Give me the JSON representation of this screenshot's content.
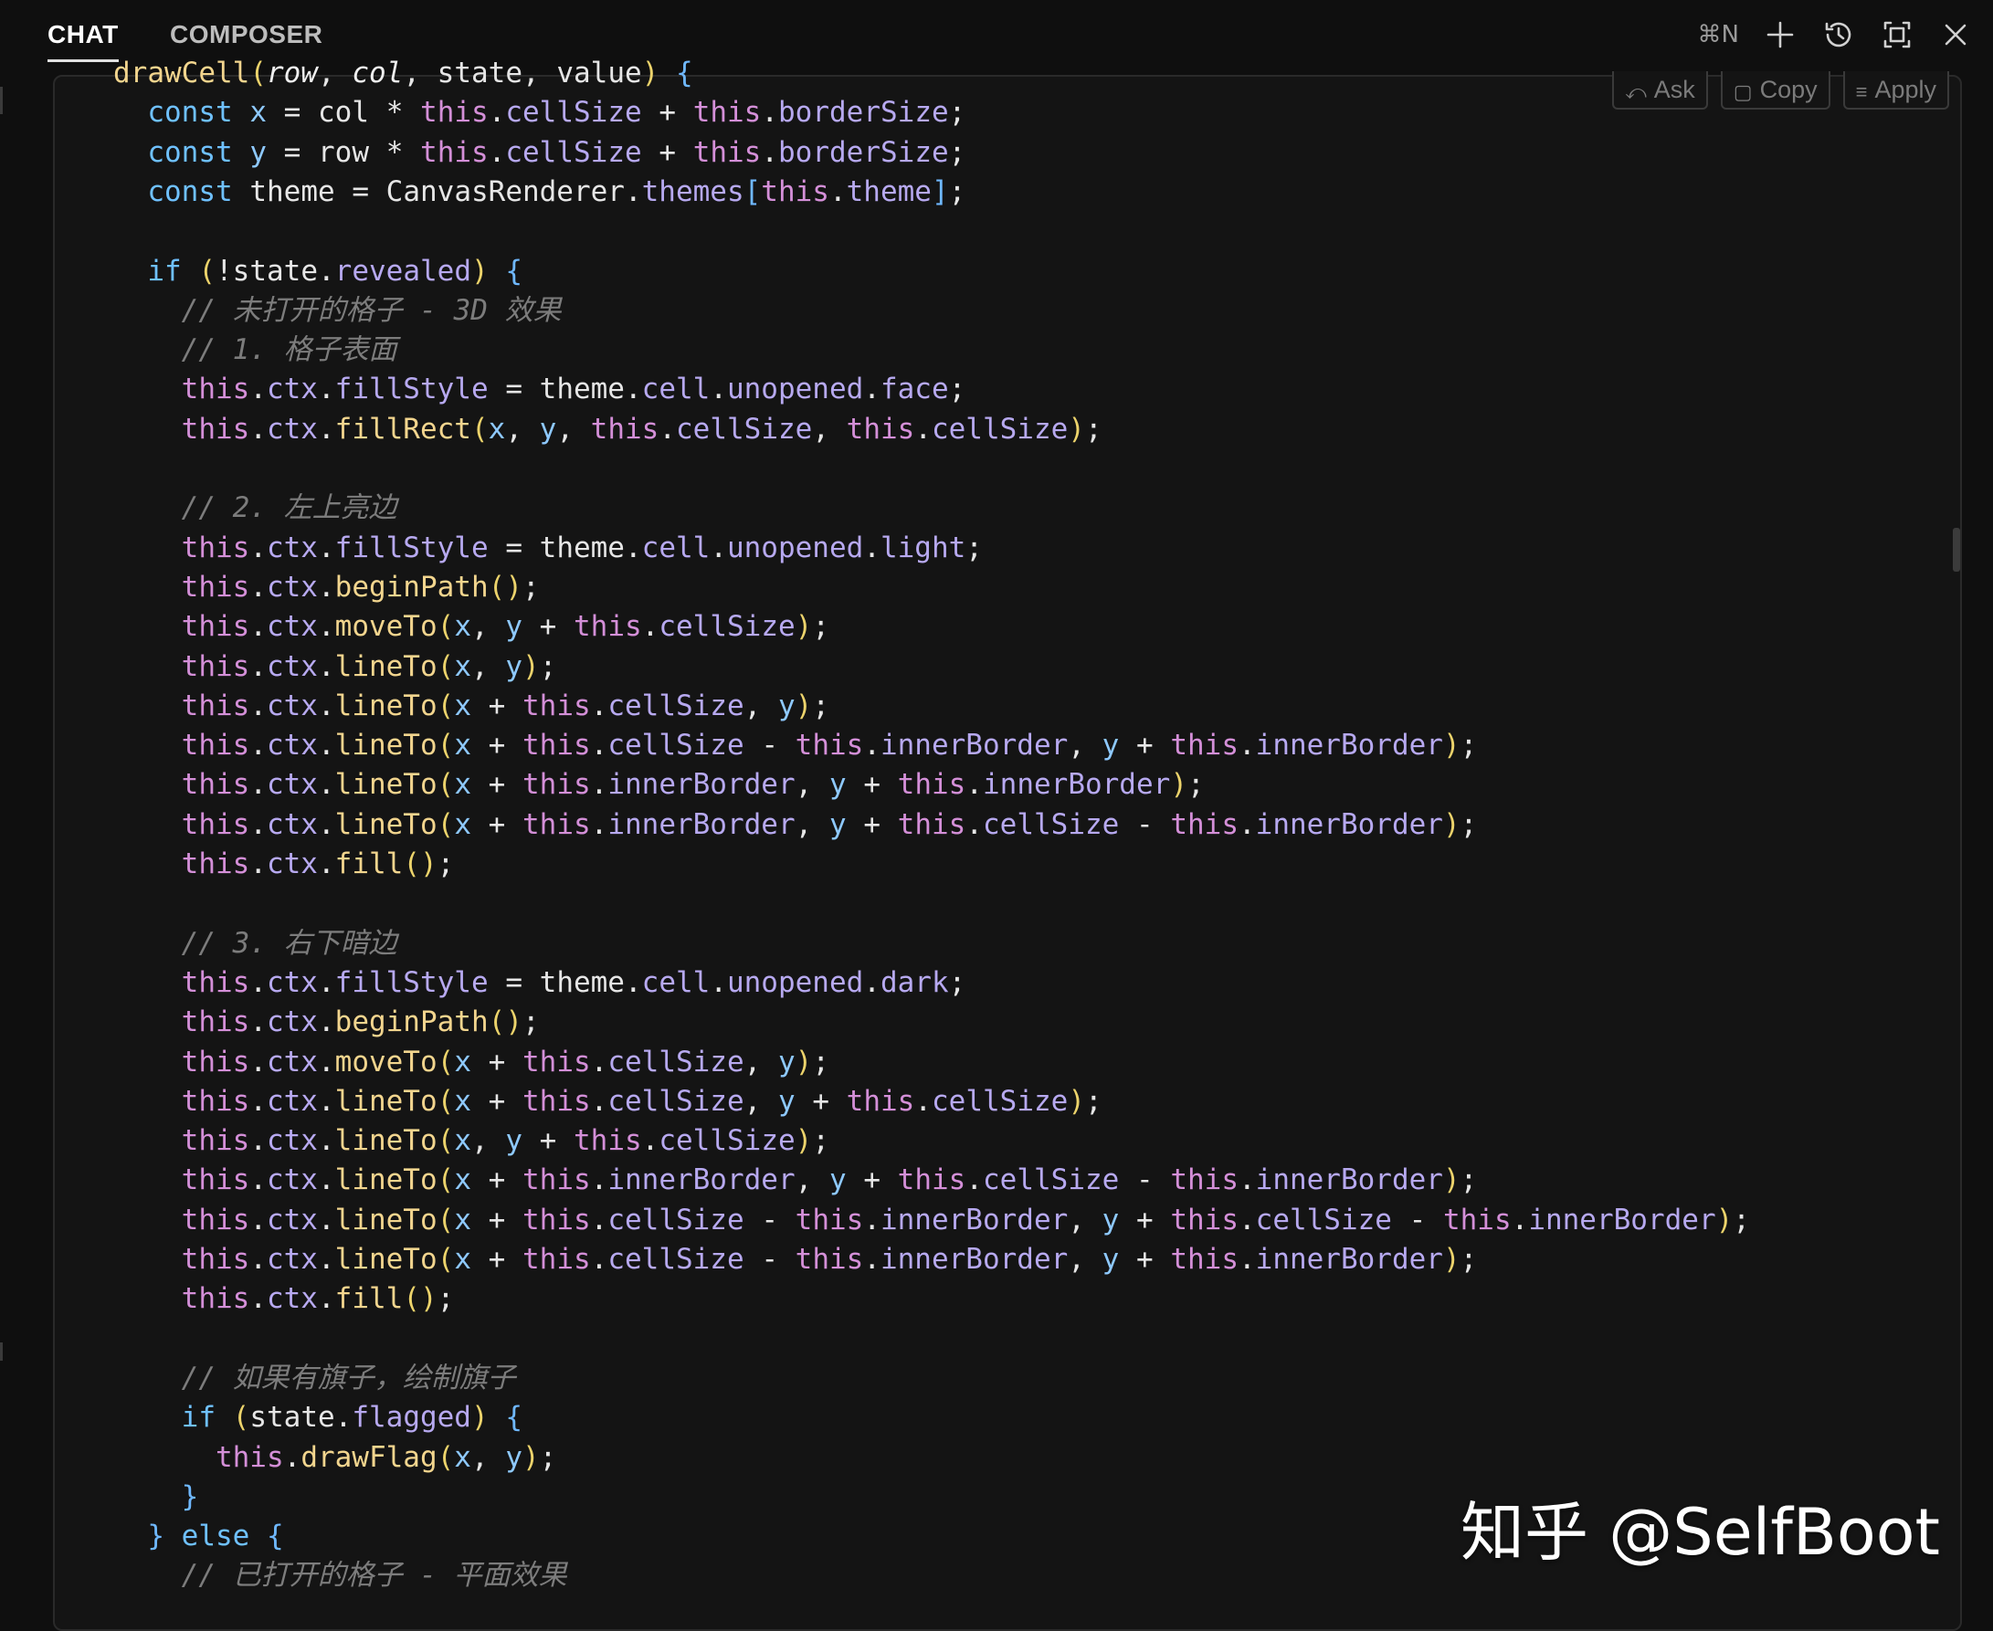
{
  "tabs": [
    {
      "label": "CHAT",
      "active": true
    },
    {
      "label": "COMPOSER",
      "active": false
    }
  ],
  "top_actions": {
    "shortcut": "⌘N",
    "icons": [
      "plus-icon",
      "history-icon",
      "maximize-icon",
      "close-icon"
    ]
  },
  "code_actions": [
    {
      "label": "Ask",
      "icon": "⤺"
    },
    {
      "label": "Copy",
      "icon": "▢"
    },
    {
      "label": "Apply",
      "icon": "≡"
    }
  ],
  "watermark": "知乎 @SelfBoot",
  "colors": {
    "background": "#0f0f0f",
    "keyword": "#6fc1ff",
    "function": "#f2d58e",
    "this": "#d48fd8",
    "property": "#b7a9f0",
    "comment": "#7c7c7c"
  },
  "code_lines": [
    "drawCell(row, col, state, value) {",
    "  const x = col * this.cellSize + this.borderSize;",
    "  const y = row * this.cellSize + this.borderSize;",
    "  const theme = CanvasRenderer.themes[this.theme];",
    "",
    "  if (!state.revealed) {",
    "    // 未打开的格子 - 3D 效果",
    "    // 1. 格子表面",
    "    this.ctx.fillStyle = theme.cell.unopened.face;",
    "    this.ctx.fillRect(x, y, this.cellSize, this.cellSize);",
    "",
    "    // 2. 左上亮边",
    "    this.ctx.fillStyle = theme.cell.unopened.light;",
    "    this.ctx.beginPath();",
    "    this.ctx.moveTo(x, y + this.cellSize);",
    "    this.ctx.lineTo(x, y);",
    "    this.ctx.lineTo(x + this.cellSize, y);",
    "    this.ctx.lineTo(x + this.cellSize - this.innerBorder, y + this.innerBorder);",
    "    this.ctx.lineTo(x + this.innerBorder, y + this.innerBorder);",
    "    this.ctx.lineTo(x + this.innerBorder, y + this.cellSize - this.innerBorder);",
    "    this.ctx.fill();",
    "",
    "    // 3. 右下暗边",
    "    this.ctx.fillStyle = theme.cell.unopened.dark;",
    "    this.ctx.beginPath();",
    "    this.ctx.moveTo(x + this.cellSize, y);",
    "    this.ctx.lineTo(x + this.cellSize, y + this.cellSize);",
    "    this.ctx.lineTo(x, y + this.cellSize);",
    "    this.ctx.lineTo(x + this.innerBorder, y + this.cellSize - this.innerBorder);",
    "    this.ctx.lineTo(x + this.cellSize - this.innerBorder, y + this.cellSize - this.innerBorder);",
    "    this.ctx.lineTo(x + this.cellSize - this.innerBorder, y + this.innerBorder);",
    "    this.ctx.fill();",
    "",
    "    // 如果有旗子，绘制旗子",
    "    if (state.flagged) {",
    "      this.drawFlag(x, y);",
    "    }",
    "  } else {",
    "    // 已打开的格子 - 平面效果"
  ]
}
